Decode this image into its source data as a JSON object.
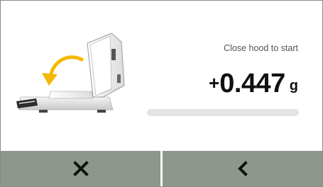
{
  "status": {
    "message": "Close hood to start"
  },
  "weight": {
    "sign": "+",
    "value": "0.447",
    "unit": "g"
  },
  "progress": {
    "fraction": 0.0
  },
  "illustration": {
    "icon": "balance-hood-closing-icon",
    "arrow_color": "#f5b800"
  },
  "footer": {
    "cancel_icon": "close-icon",
    "back_icon": "chevron-left-icon",
    "button_color": "#8d978c"
  }
}
